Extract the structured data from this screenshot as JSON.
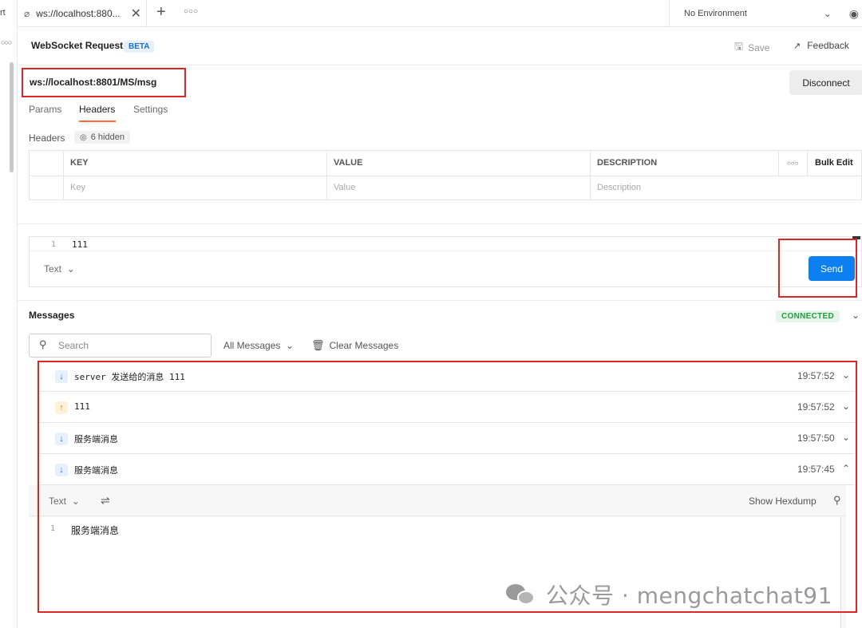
{
  "left_strip": {
    "cut_label": "rt",
    "more_icon": "dots-icon"
  },
  "tab": {
    "title": "ws://localhost:880...",
    "close": "✕",
    "plus": "+",
    "more": "○○○"
  },
  "environment": {
    "label": "No Environment"
  },
  "header": {
    "title": "WebSocket Request",
    "badge": "BETA",
    "save": "Save",
    "feedback": "Feedback"
  },
  "url": {
    "value": "ws://localhost:8801/MS/msg",
    "disconnect": "Disconnect"
  },
  "request_tabs": {
    "params": "Params",
    "headers": "Headers",
    "settings": "Settings"
  },
  "headers": {
    "label": "Headers",
    "hidden": "6 hidden",
    "columns": {
      "key": "KEY",
      "value": "VALUE",
      "description": "DESCRIPTION",
      "more": "○○○",
      "bulk": "Bulk Edit"
    },
    "placeholders": {
      "key": "Key",
      "value": "Value",
      "description": "Description"
    }
  },
  "composer": {
    "line_no": "1",
    "text": "111",
    "format": "Text",
    "send": "Send"
  },
  "messages": {
    "title": "Messages",
    "status": "CONNECTED",
    "search_placeholder": "Search",
    "filter": "All Messages",
    "clear": "Clear Messages",
    "items": [
      {
        "direction": "down",
        "text": "server 发送给的消息 111",
        "time": "19:57:52"
      },
      {
        "direction": "up",
        "text": "111",
        "time": "19:57:52"
      },
      {
        "direction": "down",
        "text": "服务端消息",
        "time": "19:57:50"
      },
      {
        "direction": "down",
        "text": "服务端消息",
        "time": "19:57:45"
      }
    ],
    "detail": {
      "format": "Text",
      "hexdump": "Show Hexdump",
      "line_no": "1",
      "value": "服务端消息"
    }
  },
  "watermark": {
    "text": "公众号 · mengchatchat91"
  },
  "colors": {
    "accent": "#0c7ff2",
    "tab_underline": "#ff6c37",
    "highlight": "#e02424",
    "connected": "#1f9d3e"
  }
}
